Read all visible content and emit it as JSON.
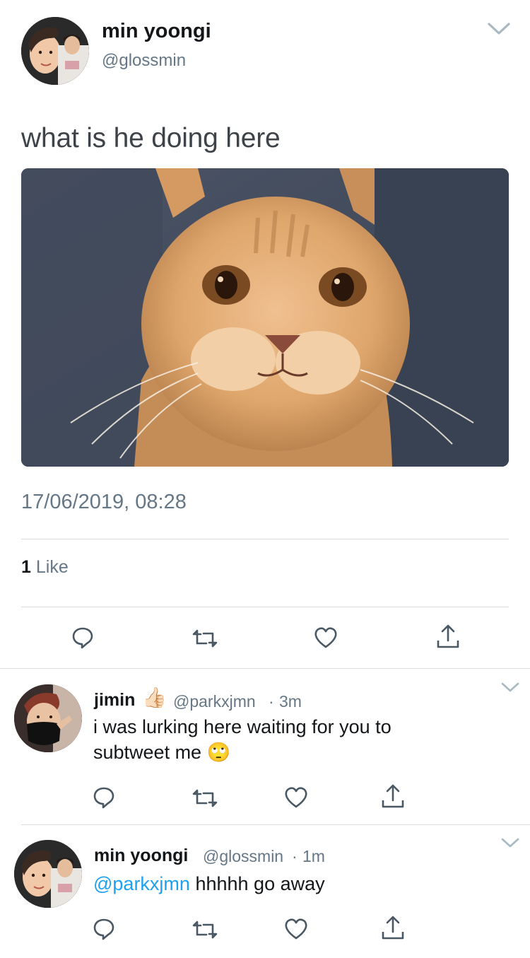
{
  "main_tweet": {
    "display_name": "min yoongi",
    "handle": "@glossmin",
    "text": "what is he doing here",
    "timestamp": "17/06/2019, 08:28",
    "like_count": "1",
    "like_label": "Like"
  },
  "replies": [
    {
      "display_name": "jimin",
      "badge_emoji": "👍🏻",
      "handle": "@parkxjmn",
      "separator": "·",
      "time": "3m",
      "text_line1": "i was lurking here waiting for you to",
      "text_line2": "subtweet me",
      "emoji": "🙄"
    },
    {
      "display_name": "min yoongi",
      "handle": "@glossmin",
      "separator": "·",
      "time": "1m",
      "mention": "@parkxjmn",
      "text": "hhhhh go away"
    }
  ],
  "icons": {
    "reply": "reply-icon",
    "retweet": "retweet-icon",
    "like": "heart-icon",
    "share": "share-icon",
    "more": "chevron-down-icon"
  },
  "colors": {
    "text_primary": "#14171a",
    "text_secondary": "#657786",
    "mention": "#1da1f2",
    "divider": "#d8dde2"
  }
}
